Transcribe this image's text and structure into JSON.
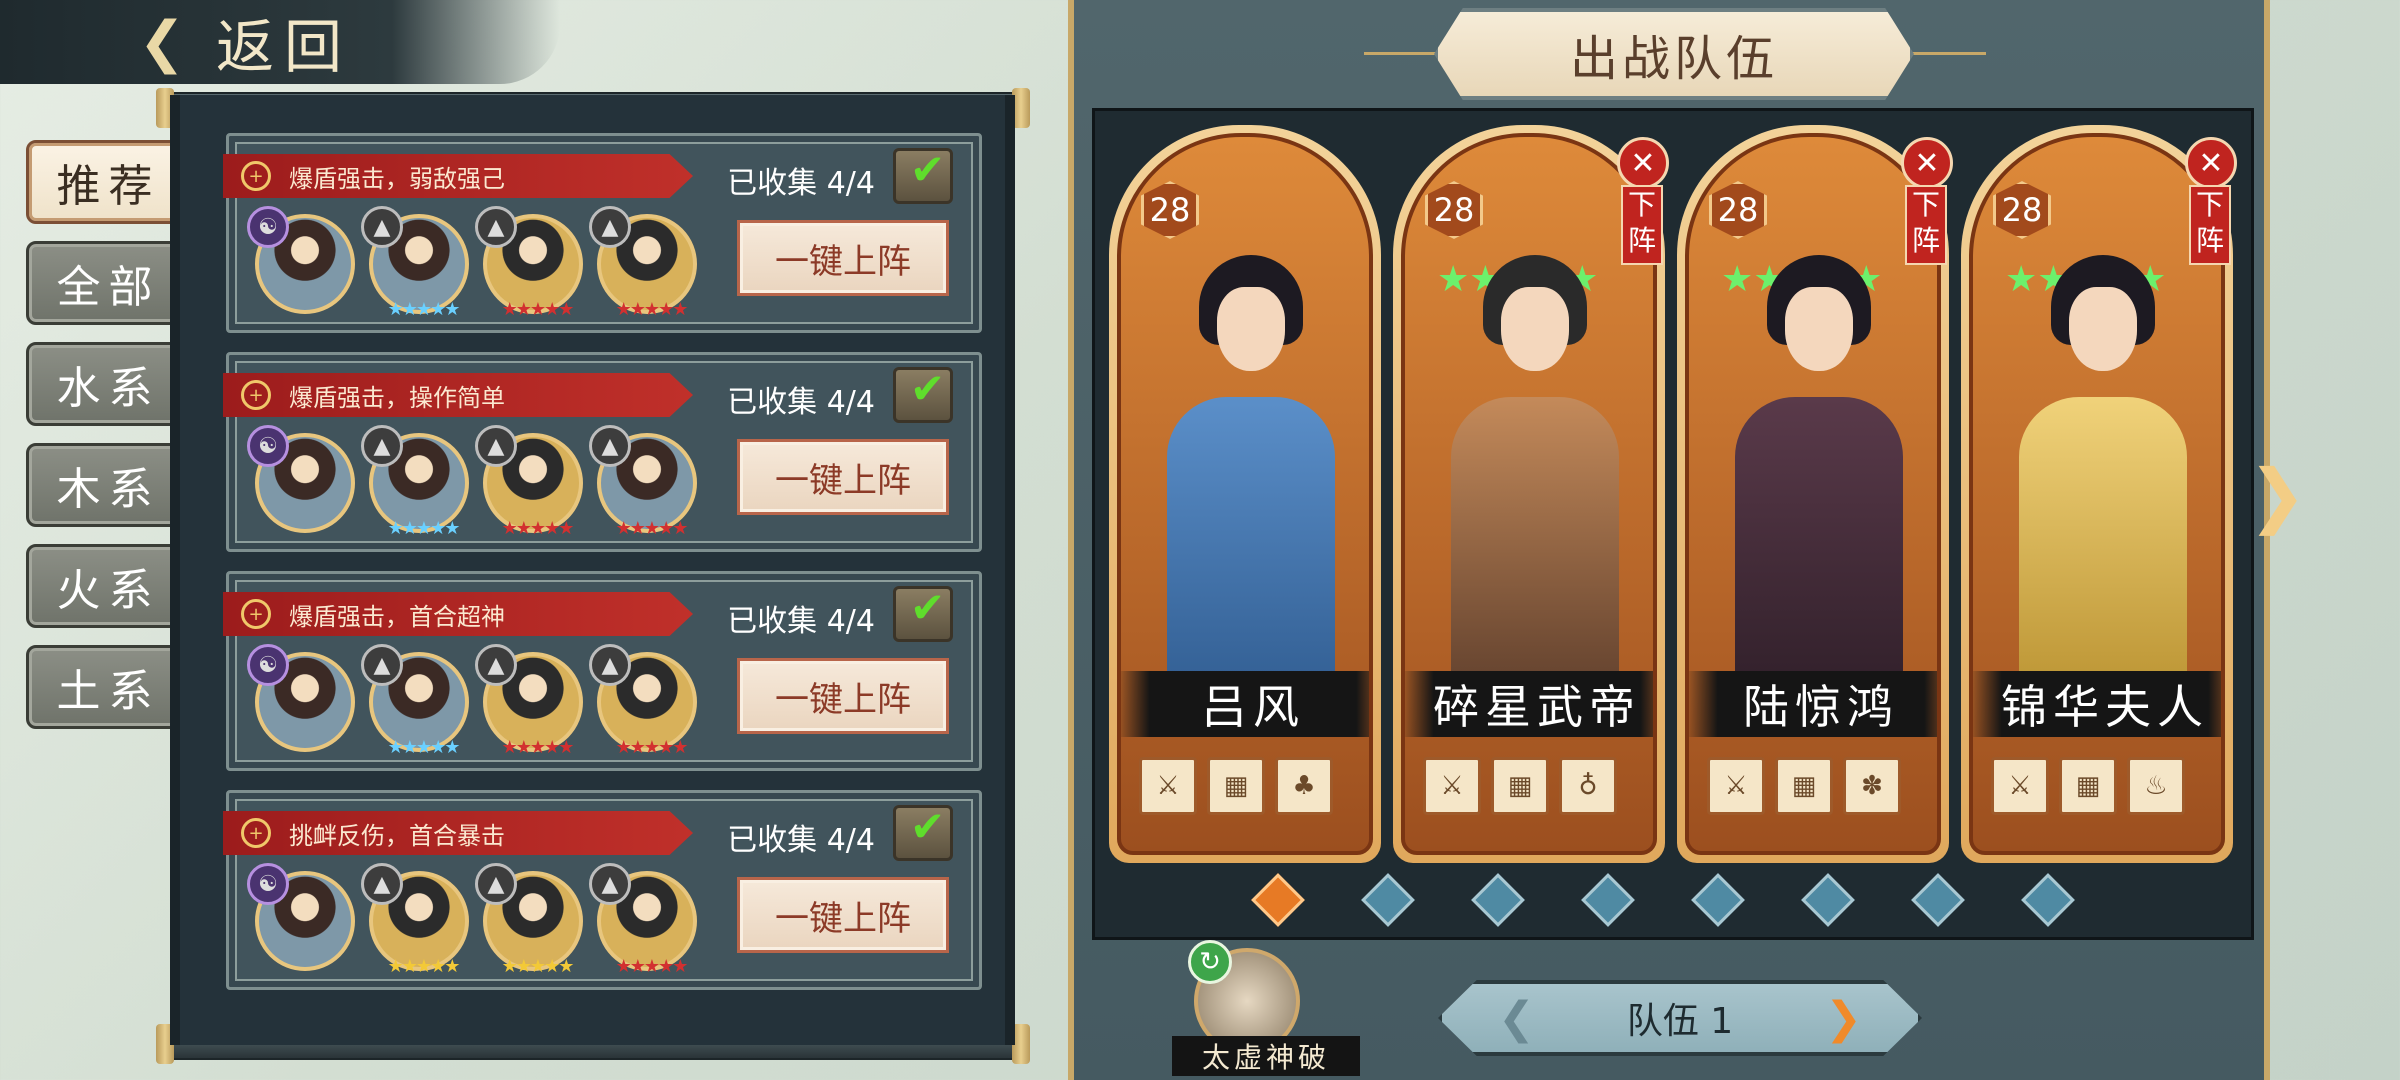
{
  "back": {
    "label": "返回"
  },
  "tabs": [
    {
      "label": "推荐",
      "active": true
    },
    {
      "label": "全部"
    },
    {
      "label": "水系"
    },
    {
      "label": "木系"
    },
    {
      "label": "火系"
    },
    {
      "label": "土系"
    }
  ],
  "teams": [
    {
      "tag": "爆盾强击，弱敌强己",
      "collect": "已收集 4/4",
      "button": "一键上阵",
      "stars": [
        "",
        "★★★★★",
        "★★★★★",
        "★★★★★"
      ]
    },
    {
      "tag": "爆盾强击，操作简单",
      "collect": "已收集 4/4",
      "button": "一键上阵",
      "stars": [
        "",
        "★★★★★",
        "★★★★★",
        "★★★★★"
      ]
    },
    {
      "tag": "爆盾强击，首合超神",
      "collect": "已收集 4/4",
      "button": "一键上阵",
      "stars": [
        "",
        "★★★★★",
        "★★★★★",
        "★★★★★"
      ]
    },
    {
      "tag": "挑衅反伤，首合暴击",
      "collect": "已收集 4/4",
      "button": "一键上阵",
      "stars": [
        "",
        "★★★★★",
        "★★★★★",
        "★★★★★"
      ]
    }
  ],
  "right": {
    "title": "出战队伍",
    "heroes": [
      {
        "name": "吕风",
        "level": "28",
        "stars": "",
        "removable": false
      },
      {
        "name": "碎星武帝",
        "level": "28",
        "stars": "★★★★★",
        "removable": true,
        "down": "下阵"
      },
      {
        "name": "陆惊鸿",
        "level": "28",
        "stars": "★★★★★",
        "removable": true,
        "down": "下阵"
      },
      {
        "name": "锦华夫人",
        "level": "28",
        "stars": "★★★★★",
        "removable": true,
        "down": "下阵"
      }
    ],
    "skill": "太虚神破",
    "team_selector": {
      "label": "队伍 1"
    },
    "colors": {
      "accent": "#c8a868",
      "remove": "#c0241f",
      "active_dot": "#e77a25"
    }
  }
}
